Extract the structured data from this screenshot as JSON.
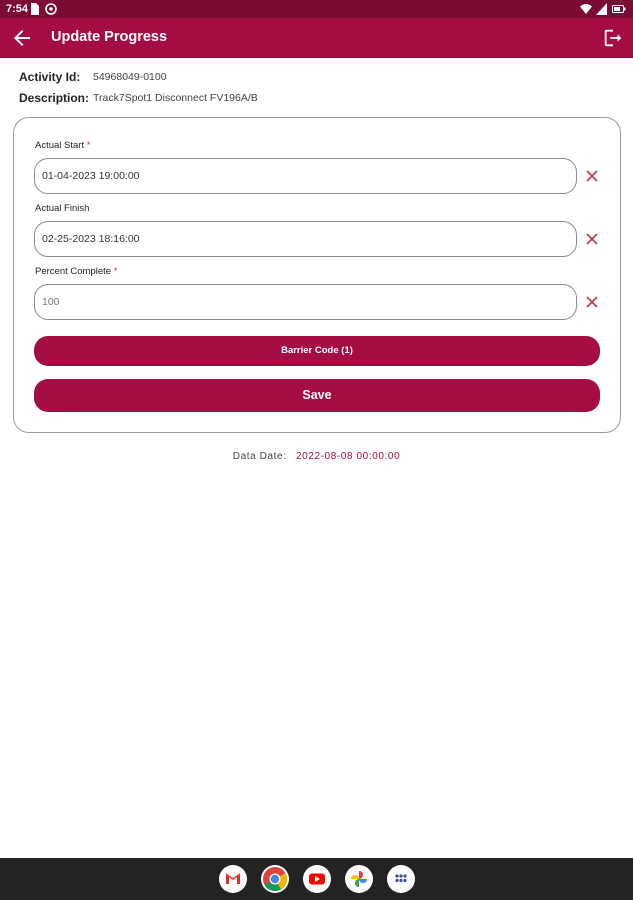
{
  "status_bar": {
    "time": "7:54"
  },
  "app_bar": {
    "title": "Update Progress"
  },
  "activity": {
    "id_label": "Activity Id:",
    "id_value": "54968049-0100",
    "description_label": "Description:",
    "description_value": "Track7Spot1 Disconnect FV196A/B"
  },
  "form": {
    "actual_start": {
      "label": "Actual Start",
      "required_mark": "*",
      "value": "01-04-2023 19:00:00"
    },
    "actual_finish": {
      "label": "Actual Finish",
      "value": "02-25-2023 18:16:00"
    },
    "percent_complete": {
      "label": "Percent Complete",
      "required_mark": "*",
      "value": "100"
    },
    "barrier_button": "Barrier Code (1)",
    "save_button": "Save"
  },
  "data_date": {
    "label": "Data Date:",
    "value": "2022-08-08 00:00:00"
  },
  "dock": {
    "apps": [
      "gmail-icon",
      "chrome-icon",
      "youtube-icon",
      "photos-icon",
      "app-drawer-icon"
    ]
  },
  "colors": {
    "primary": "#a50c43",
    "status_bar": "#7b0a35",
    "clear_icon": "#c0344a",
    "nav_bar": "#232323"
  }
}
